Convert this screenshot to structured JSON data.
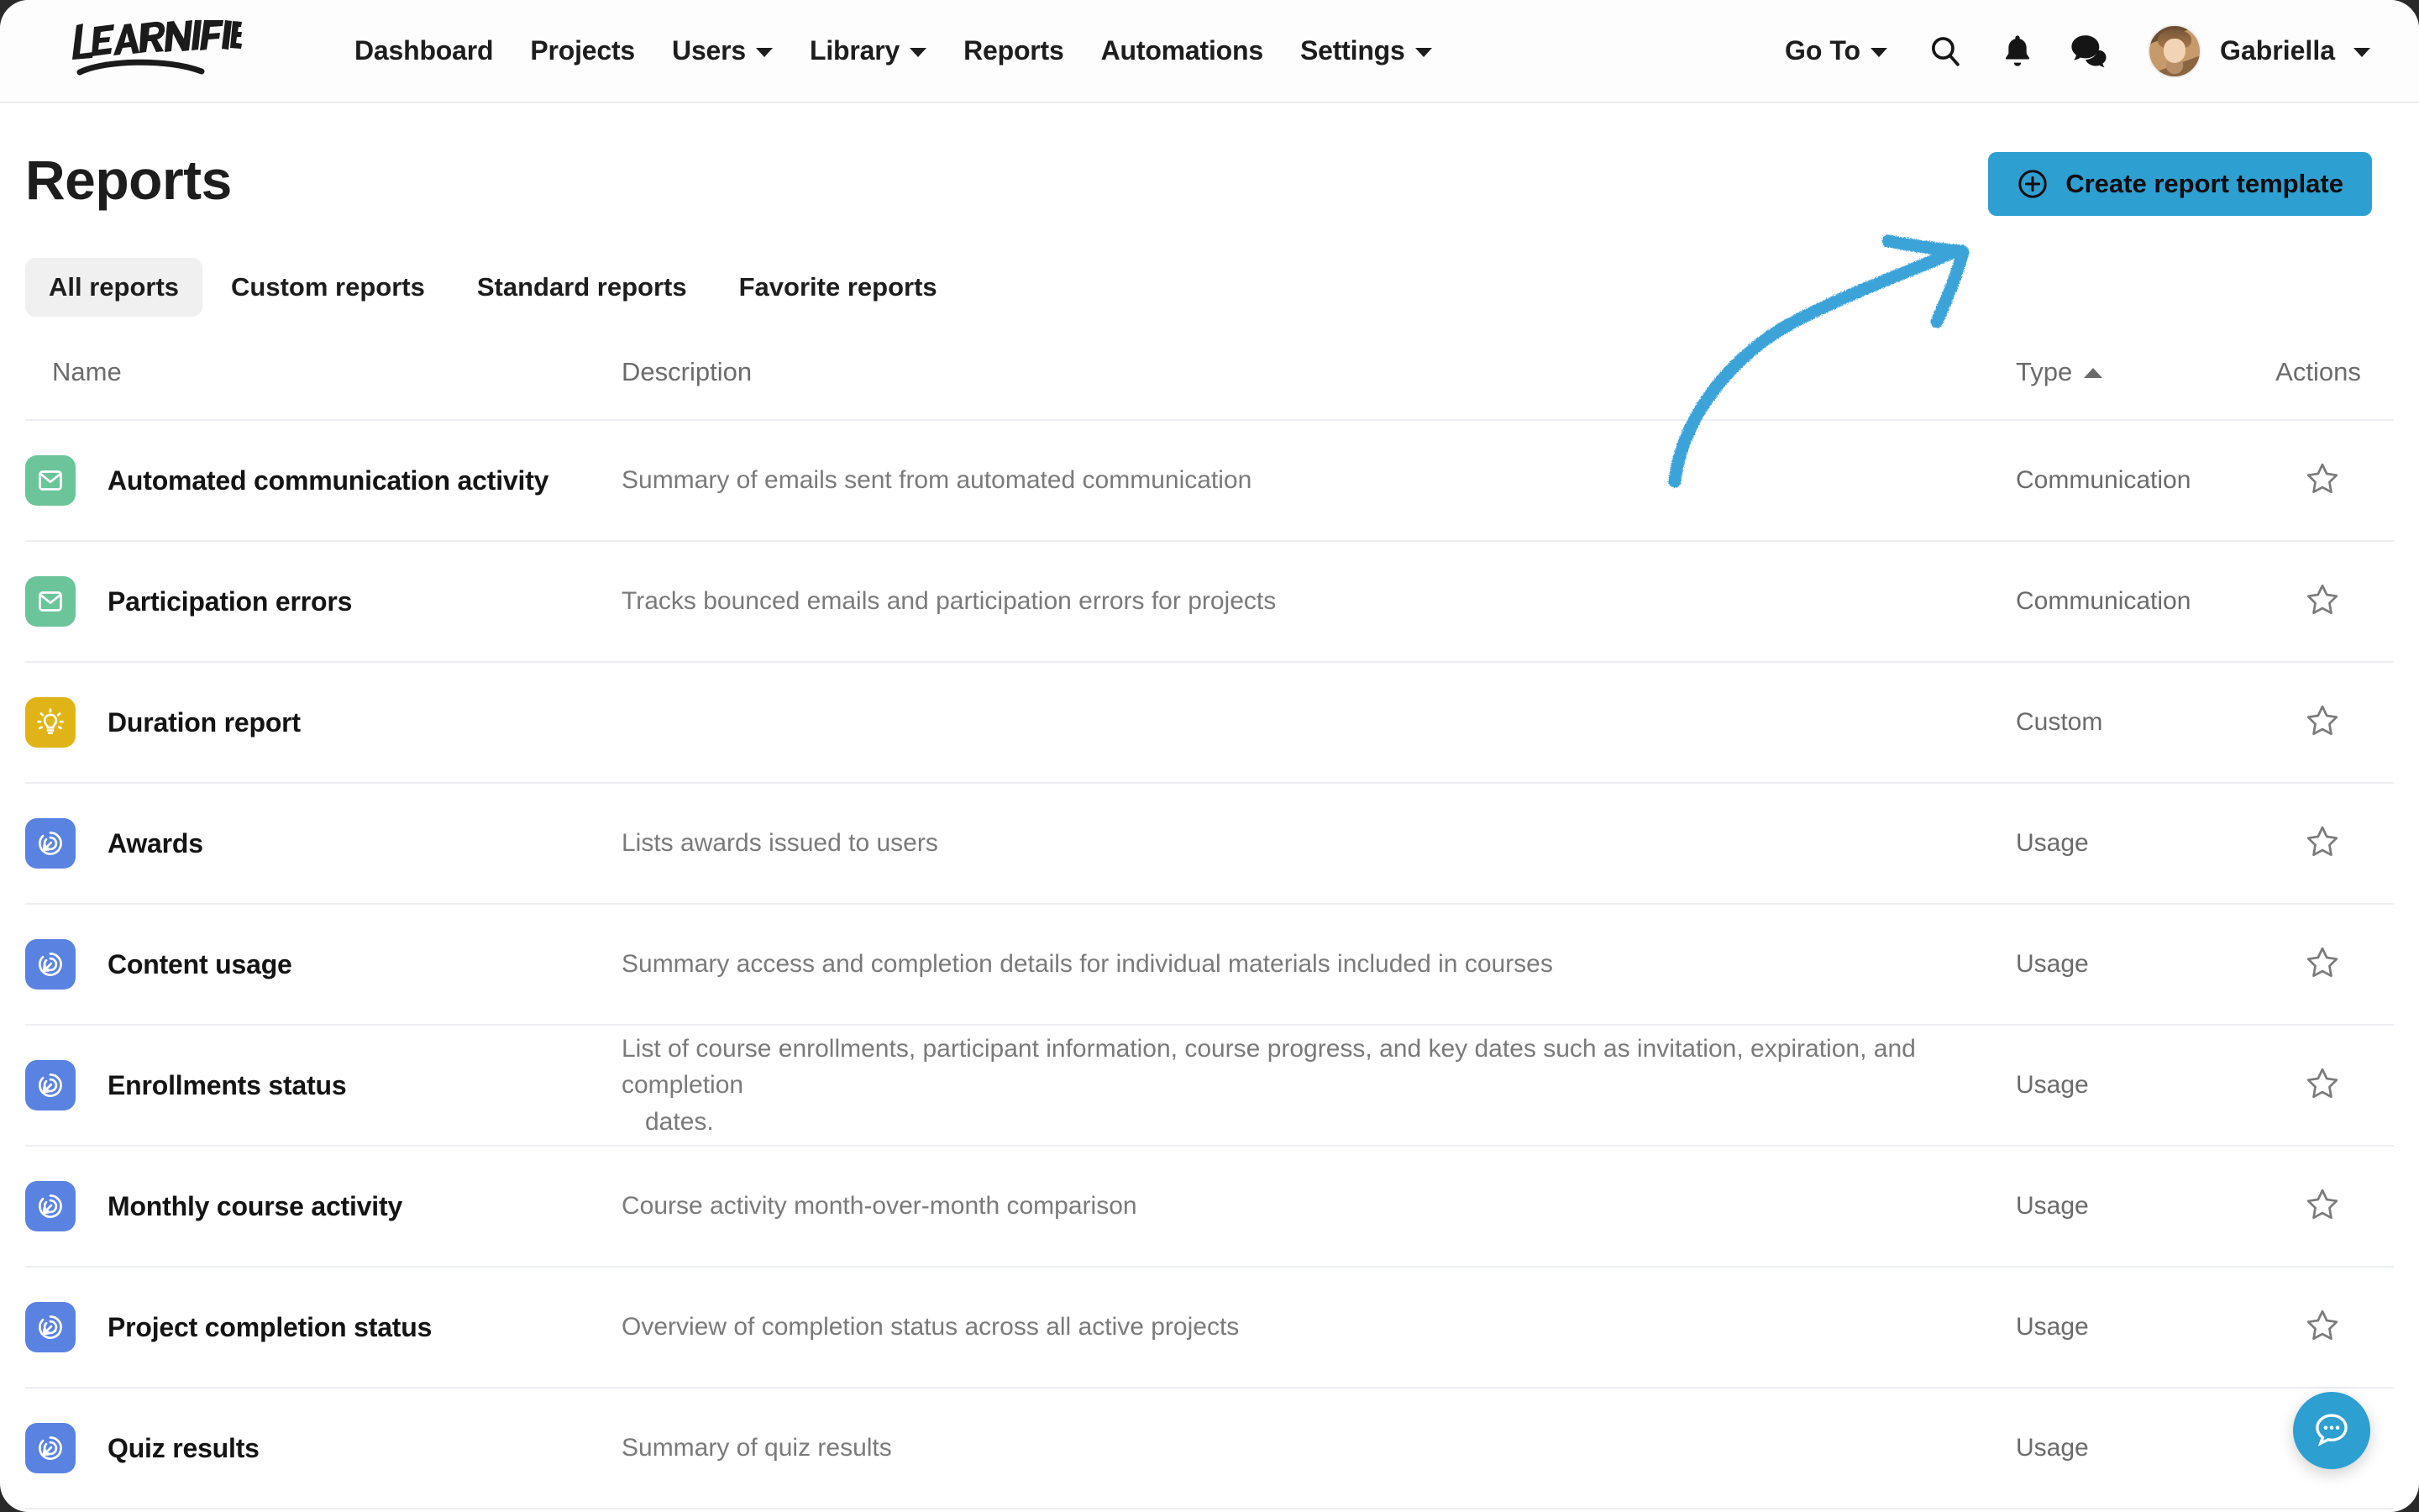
{
  "brand": {
    "logo_text": "LEARNIFIER"
  },
  "nav": {
    "links": [
      {
        "label": "Dashboard",
        "has_caret": false
      },
      {
        "label": "Projects",
        "has_caret": false
      },
      {
        "label": "Users",
        "has_caret": true
      },
      {
        "label": "Library",
        "has_caret": true
      },
      {
        "label": "Reports",
        "has_caret": false
      },
      {
        "label": "Automations",
        "has_caret": false
      },
      {
        "label": "Settings",
        "has_caret": true
      }
    ],
    "goto_label": "Go To",
    "icons": [
      "search-icon",
      "bell-icon",
      "chat-icon"
    ],
    "user_name": "Gabriella"
  },
  "header": {
    "title": "Reports",
    "create_button": "Create report template"
  },
  "tabs": [
    {
      "label": "All reports",
      "active": true
    },
    {
      "label": "Custom reports",
      "active": false
    },
    {
      "label": "Standard reports",
      "active": false
    },
    {
      "label": "Favorite reports",
      "active": false
    }
  ],
  "table": {
    "columns": {
      "name": "Name",
      "description": "Description",
      "type": "Type",
      "actions": "Actions"
    },
    "sort": {
      "column": "Type",
      "direction": "asc"
    },
    "rows": [
      {
        "icon": "envelope-icon",
        "icon_color": "#6cc49a",
        "name": "Automated communication activity",
        "description": "Summary of emails sent from automated communication",
        "description_extra": "",
        "type": "Communication",
        "favorite": false
      },
      {
        "icon": "envelope-icon",
        "icon_color": "#6cc49a",
        "name": "Participation errors",
        "description": "Tracks bounced emails and participation errors for projects",
        "description_extra": "",
        "type": "Communication",
        "favorite": false
      },
      {
        "icon": "lightbulb-icon",
        "icon_color": "#e0b417",
        "name": "Duration report",
        "description": "",
        "description_extra": "",
        "type": "Custom",
        "favorite": false
      },
      {
        "icon": "gauge-icon",
        "icon_color": "#5a82e0",
        "name": "Awards",
        "description": "Lists awards issued to users",
        "description_extra": "",
        "type": "Usage",
        "favorite": false
      },
      {
        "icon": "gauge-icon",
        "icon_color": "#5a82e0",
        "name": "Content usage",
        "description": "Summary access and completion details for individual materials included in courses",
        "description_extra": "",
        "type": "Usage",
        "favorite": false
      },
      {
        "icon": "gauge-icon",
        "icon_color": "#5a82e0",
        "name": "Enrollments status",
        "description": "List of course enrollments, participant information, course progress, and key dates such as invitation, expiration, and completion",
        "description_extra": "dates.",
        "type": "Usage",
        "favorite": false
      },
      {
        "icon": "gauge-icon",
        "icon_color": "#5a82e0",
        "name": "Monthly course activity",
        "description": "Course activity month-over-month comparison",
        "description_extra": "",
        "type": "Usage",
        "favorite": false
      },
      {
        "icon": "gauge-icon",
        "icon_color": "#5a82e0",
        "name": "Project completion status",
        "description": "Overview of completion status across all active projects",
        "description_extra": "",
        "type": "Usage",
        "favorite": false
      },
      {
        "icon": "gauge-icon",
        "icon_color": "#5a82e0",
        "name": "Quiz results",
        "description": "Summary of quiz results",
        "description_extra": "",
        "type": "Usage",
        "favorite": false
      }
    ]
  },
  "annotation": {
    "type": "hand-drawn-arrow",
    "color": "#3ba3d8",
    "points_to": "create-report-template-button"
  },
  "chat_fab": {
    "icon": "chat-bubble-icon",
    "color": "#2e9fd1"
  },
  "colors": {
    "accent_blue": "#2e9fd1",
    "icon_green": "#6cc49a",
    "icon_yellow": "#e0b417",
    "icon_blue": "#5a82e0",
    "tab_active_bg": "#f0f0f0",
    "divider": "#eceef2"
  }
}
